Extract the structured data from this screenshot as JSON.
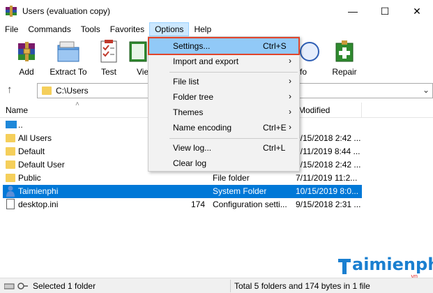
{
  "window": {
    "title": "Users (evaluation copy)",
    "minimize": "—",
    "maximize": "☐",
    "close": "✕"
  },
  "menu": [
    "File",
    "Commands",
    "Tools",
    "Favorites",
    "Options",
    "Help"
  ],
  "toolbar": {
    "add": "Add",
    "extract": "Extract To",
    "test": "Test",
    "view": "Vie",
    "info": "fo",
    "repair": "Repair"
  },
  "address": {
    "path": "C:\\Users",
    "up_icon": "up-arrow-icon"
  },
  "columns": {
    "name": "Name",
    "modified": "Modified"
  },
  "rows": [
    {
      "name": "..",
      "size": "",
      "type": "",
      "modified": "",
      "icon": "up-folder-icon"
    },
    {
      "name": "All Users",
      "size": "",
      "type": "",
      "modified": "9/15/2018 2:42 ...",
      "icon": "folder-icon"
    },
    {
      "name": "Default",
      "size": "",
      "type": "",
      "modified": "7/11/2019 8:44 ...",
      "icon": "folder-icon"
    },
    {
      "name": "Default User",
      "size": "",
      "type": "",
      "modified": "9/15/2018 2:42 ...",
      "icon": "folder-icon"
    },
    {
      "name": "Public",
      "size": "",
      "type": "File folder",
      "modified": "7/11/2019 11:2...",
      "icon": "folder-icon"
    },
    {
      "name": "Taimienphi",
      "size": "",
      "type": "System Folder",
      "modified": "10/15/2019 8:0...",
      "icon": "user-folder-icon",
      "selected": true
    },
    {
      "name": "desktop.ini",
      "size": "174",
      "type": "Configuration setti...",
      "modified": "9/15/2018 2:31 ...",
      "icon": "ini-file-icon"
    }
  ],
  "options_menu": {
    "settings": "Settings...",
    "settings_shortcut": "Ctrl+S",
    "import_export": "Import and export",
    "file_list": "File list",
    "folder_tree": "Folder tree",
    "themes": "Themes",
    "name_encoding": "Name encoding",
    "name_encoding_shortcut": "Ctrl+E",
    "view_log": "View log...",
    "view_log_shortcut": "Ctrl+L",
    "clear_log": "Clear log",
    "submenu_arrow": "›"
  },
  "status": {
    "left": "Selected 1 folder",
    "right": "Total 5 folders and 174 bytes in 1 file"
  },
  "watermark": {
    "text": "aimienphi",
    "sub": ".vn"
  },
  "colors": {
    "selection": "#0078d7",
    "menu_highlight": "#91c9f7",
    "highlight_border": "#e0442a"
  }
}
